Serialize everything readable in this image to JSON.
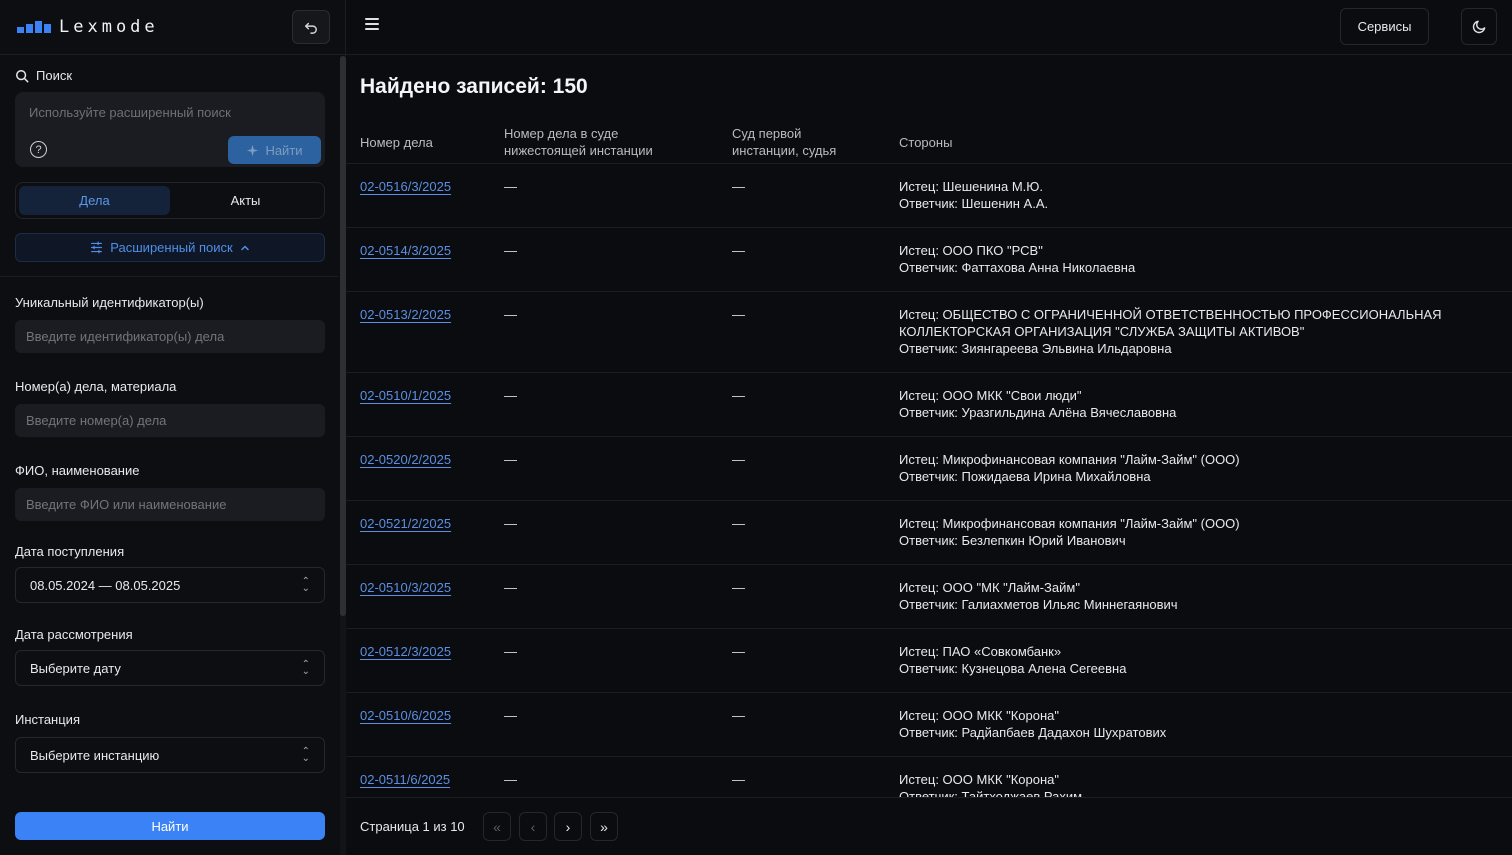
{
  "brand": {
    "name": "Lexmode"
  },
  "sidebar": {
    "search_title": "Поиск",
    "search_placeholder": "Используйте расширенный поиск",
    "search_button": "Найти",
    "tabs": [
      {
        "label": "Дела",
        "active": true
      },
      {
        "label": "Акты",
        "active": false
      }
    ],
    "advanced_label": "Расширенный поиск",
    "fields": {
      "uid_label": "Уникальный идентификатор(ы)",
      "uid_placeholder": "Введите идентификатор(ы) дела",
      "number_label": "Номер(а) дела, материала",
      "number_placeholder": "Введите номер(а) дела",
      "name_label": "ФИО, наименование",
      "name_placeholder": "Введите ФИО или наименование",
      "receipt_label": "Дата поступления",
      "receipt_value": "08.05.2024 — 08.05.2025",
      "review_label": "Дата рассмотрения",
      "review_value": "Выберите дату",
      "instance_label": "Инстанция",
      "instance_value": "Выберите инстанцию"
    },
    "submit_label": "Найти"
  },
  "topbar": {
    "services_label": "Сервисы"
  },
  "main": {
    "title": "Найдено записей: 150",
    "columns": {
      "case": "Номер дела",
      "lower_a": "Номер дела в суде",
      "lower_b": "нижестоящей инстанции",
      "first_a": "Суд первой",
      "first_b": "инстанции, судья",
      "parties": "Стороны"
    },
    "rows": [
      {
        "case": "02-0516/3/2025",
        "lower": "—",
        "first": "—",
        "parties": [
          "Истец: Шешенина М.Ю.",
          "Ответчик: Шешенин А.А."
        ]
      },
      {
        "case": "02-0514/3/2025",
        "lower": "—",
        "first": "—",
        "parties": [
          "Истец: ООО ПКО \"РСВ\"",
          "Ответчик: Фаттахова Анна Николаевна"
        ]
      },
      {
        "case": "02-0513/2/2025",
        "lower": "—",
        "first": "—",
        "parties": [
          "Истец: ОБЩЕСТВО С ОГРАНИЧЕННОЙ ОТВЕТСТВЕННОСТЬЮ ПРОФЕССИОНАЛЬНАЯ",
          "КОЛЛЕКТОРСКАЯ ОРГАНИЗАЦИЯ \"СЛУЖБА ЗАЩИТЫ АКТИВОВ\"",
          "Ответчик: Зиянгареева Эльвина Ильдаровна"
        ]
      },
      {
        "case": "02-0510/1/2025",
        "lower": "—",
        "first": "—",
        "parties": [
          "Истец: ООО МКК \"Свои люди\"",
          "Ответчик: Уразгильдина Алёна Вячеславовна"
        ]
      },
      {
        "case": "02-0520/2/2025",
        "lower": "—",
        "first": "—",
        "parties": [
          "Истец: Микрофинансовая компания \"Лайм-Займ\" (ООО)",
          "Ответчик: Пожидаева Ирина Михайловна"
        ]
      },
      {
        "case": "02-0521/2/2025",
        "lower": "—",
        "first": "—",
        "parties": [
          "Истец: Микрофинансовая компания \"Лайм-Займ\" (ООО)",
          "Ответчик: Безлепкин Юрий Иванович"
        ]
      },
      {
        "case": "02-0510/3/2025",
        "lower": "—",
        "first": "—",
        "parties": [
          "Истец: ООО \"МК \"Лайм-Займ\"",
          "Ответчик: Галиахметов Ильяс Миннегаянович"
        ]
      },
      {
        "case": "02-0512/3/2025",
        "lower": "—",
        "first": "—",
        "parties": [
          "Истец: ПАО «Совкомбанк»",
          "Ответчик: Кузнецова Алена Сегеевна"
        ]
      },
      {
        "case": "02-0510/6/2025",
        "lower": "—",
        "first": "—",
        "parties": [
          "Истец: ООО МКК \"Корона\"",
          "Ответчик: Радйапбаев Дадахон Шухратових"
        ]
      },
      {
        "case": "02-0511/6/2025",
        "lower": "—",
        "first": "—",
        "parties": [
          "Истец: ООО МКК \"Корона\"",
          "Ответчик: Тайтходжаев Рахим"
        ]
      }
    ]
  },
  "pagination": {
    "text": "Страница 1 из 10"
  },
  "colors": {
    "accent": "#3b82f6",
    "link": "#5b8fe3",
    "background": "#0b0c0f"
  }
}
